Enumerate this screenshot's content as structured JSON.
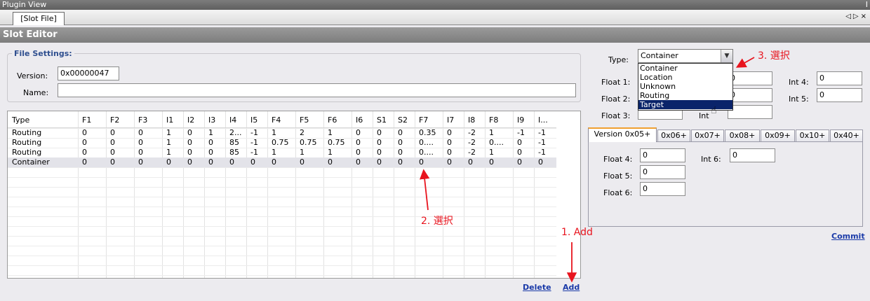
{
  "window": {
    "title": "Plugin View",
    "title_right": "I"
  },
  "tabs": {
    "file_tab": "[Slot File]",
    "nav_prev": "◁",
    "nav_next": "▷",
    "nav_close": "×"
  },
  "editor": {
    "title": "Slot Editor"
  },
  "file_settings": {
    "legend": "File Settings:",
    "version_label": "Version:",
    "version_value": "0x00000047",
    "name_label": "Name:",
    "name_value": ""
  },
  "grid": {
    "columns": [
      "Type",
      "F1",
      "F2",
      "F3",
      "I1",
      "I2",
      "I3",
      "I4",
      "I5",
      "F4",
      "F5",
      "F6",
      "I6",
      "S1",
      "S2",
      "F7",
      "I7",
      "I8",
      "F8",
      "I9",
      "I..."
    ],
    "rows": [
      [
        "Routing",
        "0",
        "0",
        "0",
        "1",
        "0",
        "1",
        "2...",
        "-1",
        "1",
        "2",
        "1",
        "0",
        "0",
        "0",
        "0.35",
        "0",
        "-2",
        "1",
        "-1",
        "-1"
      ],
      [
        "Routing",
        "0",
        "0",
        "0",
        "1",
        "0",
        "0",
        "85",
        "-1",
        "0.75",
        "0.75",
        "0.75",
        "0",
        "0",
        "0",
        "0....",
        "0",
        "-2",
        "0....",
        "0",
        "-1"
      ],
      [
        "Routing",
        "0",
        "0",
        "0",
        "1",
        "0",
        "0",
        "85",
        "-1",
        "1",
        "1",
        "1",
        "0",
        "0",
        "0",
        "0....",
        "0",
        "-2",
        "1",
        "0",
        "-1"
      ],
      [
        "Container",
        "0",
        "0",
        "0",
        "0",
        "0",
        "0",
        "0",
        "0",
        "0",
        "0",
        "0",
        "0",
        "0",
        "0",
        "0",
        "0",
        "0",
        "0",
        "0",
        "0"
      ]
    ]
  },
  "actions": {
    "delete_label": "Delete",
    "add_label": "Add",
    "commit_label": "Commit"
  },
  "slot": {
    "type_label": "Type:",
    "type_value": "Container",
    "type_options": [
      "Container",
      "Location",
      "Unknown",
      "Routing",
      "Target"
    ],
    "highlighted_option": "Target",
    "float1_label": "Float 1:",
    "float1_value": "",
    "float2_label": "Float 2:",
    "float2_value": "",
    "float3_label": "Float 3:",
    "float3_value": "",
    "int4_label": "Int 4:",
    "int4_value": "0",
    "int5_label": "Int 5:",
    "int5_value": "0",
    "int_label": "Int",
    "int_field_value": "0",
    "int_field2_value": "0"
  },
  "version_tabs": [
    "Version 0x05+",
    "0x06+",
    "0x07+",
    "0x08+",
    "0x09+",
    "0x10+",
    "0x40+"
  ],
  "version_panel": {
    "float4_label": "Float 4:",
    "float4_value": "0",
    "float5_label": "Float 5:",
    "float5_value": "0",
    "float6_label": "Float 6:",
    "float6_value": "0",
    "int6_label": "Int 6:",
    "int6_value": "0"
  },
  "annotations": {
    "step1": "1. Add",
    "step2": "2. 選択",
    "step3": "3. 選択"
  },
  "colors": {
    "annotation": "#e8141e",
    "link": "#1a3aa8",
    "highlight": "#0a246a",
    "active_tab_accent": "#f0a030"
  }
}
